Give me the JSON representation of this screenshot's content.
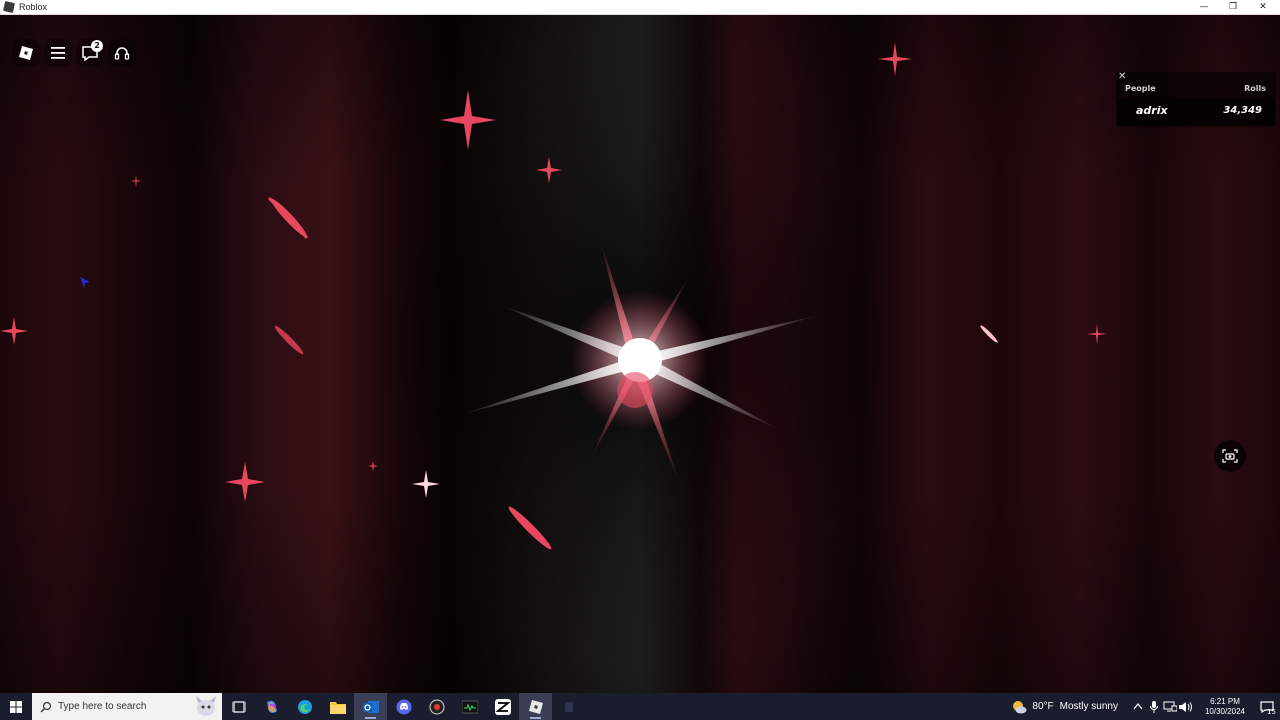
{
  "window": {
    "title": "Roblox",
    "minimize_glyph": "—",
    "restore_glyph": "❐",
    "close_glyph": "✕"
  },
  "toolbar": {
    "notification_count": "2",
    "icons": [
      "roblox-logo-icon",
      "menu-icon",
      "chat-icon",
      "voice-icon"
    ]
  },
  "leaderboard": {
    "close_glyph": "✕",
    "columns": [
      "People",
      "Rolls"
    ],
    "rows": [
      {
        "name": "adrix",
        "rolls": "34,349"
      }
    ]
  },
  "taskbar": {
    "search_placeholder": "Type here to search",
    "weather_temp": "80°F",
    "weather_condition": "Mostly sunny",
    "time": "6:21 PM",
    "date": "10/30/2024",
    "notification_count": "15"
  },
  "colors": {
    "sparkle": "#e8475e",
    "taskbar": "#1a1d2e"
  }
}
